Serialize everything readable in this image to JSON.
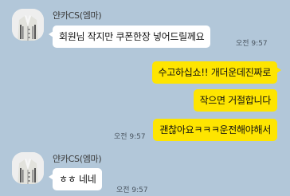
{
  "colors": {
    "background": "#b2c7d9",
    "incoming_bubble": "#ffffff",
    "outgoing_bubble": "#fee500"
  },
  "messages": {
    "m1": {
      "sender": "얀카CS(엠마)",
      "avatar_icon": "avatar-cardigan-icon",
      "text": "회원님 작지만 쿠폰한장 넣어드릴께요",
      "time": "오전 9:57"
    },
    "m2": {
      "text": "수고하십쇼!! 개더운데진짜로"
    },
    "m3": {
      "text": "작으면 거절합니다"
    },
    "m4": {
      "text": "괜찮아요ㅋㅋㅋ운전해야해서",
      "time": "오전 9:57"
    },
    "m5": {
      "sender": "얀카CS(엠마)",
      "avatar_icon": "avatar-cardigan-icon",
      "text": "ㅎㅎ 네네",
      "time": "오전 9:57"
    }
  }
}
